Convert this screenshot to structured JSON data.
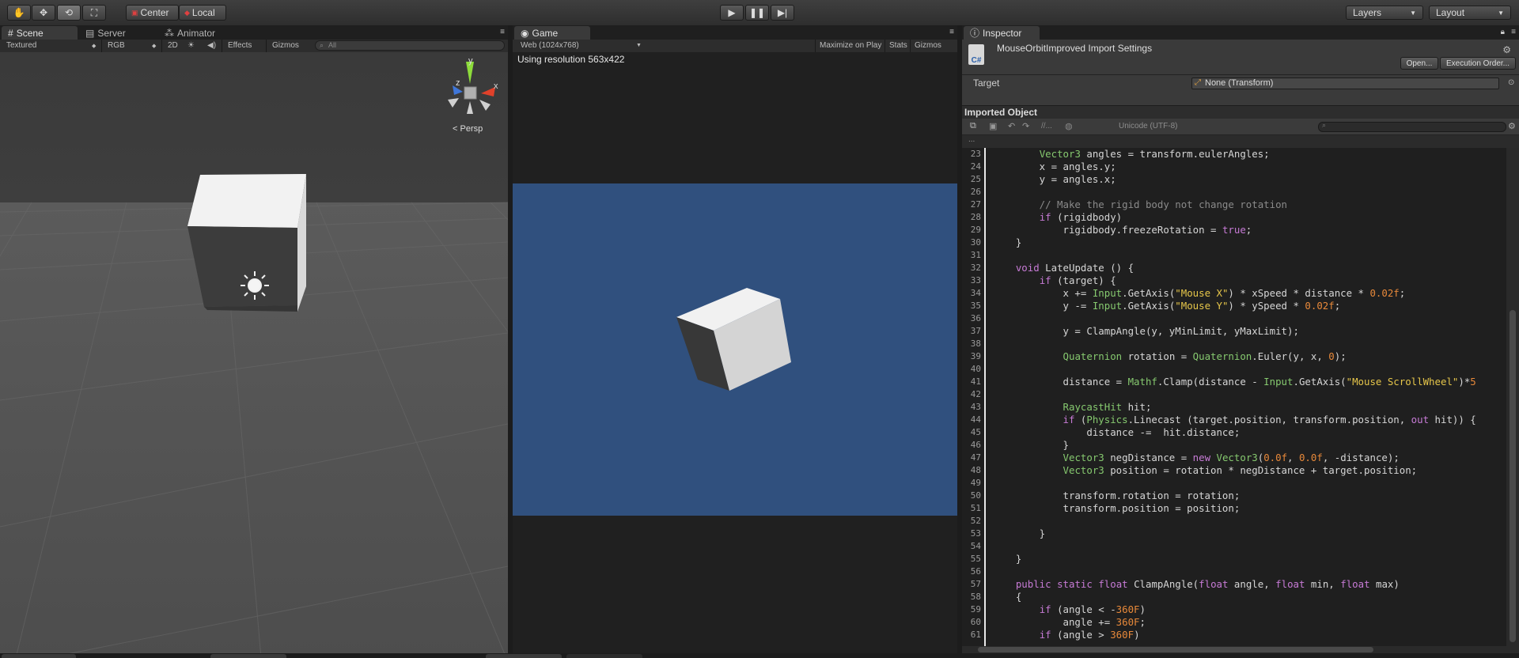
{
  "toolbar": {
    "pivot_center": "Center",
    "pivot_local": "Local",
    "layers": "Layers",
    "layout": "Layout"
  },
  "scene": {
    "tab_scene": "Scene",
    "tab_server": "Server",
    "tab_animator": "Animator",
    "draw_mode": "Textured",
    "render_mode": "RGB",
    "btn_2d": "2D",
    "effects": "Effects",
    "gizmos": "Gizmos",
    "search_placeholder": "All",
    "persp": "Persp",
    "gizmo_x": "x",
    "gizmo_y": "y",
    "gizmo_z": "z"
  },
  "game": {
    "tab": "Game",
    "resolution": "Web (1024x768)",
    "maximize": "Maximize on Play",
    "stats": "Stats",
    "gizmos": "Gizmos",
    "status": "Using resolution 563x422",
    "bg_color": "#30507e"
  },
  "inspector": {
    "tab": "Inspector",
    "title": "MouseOrbitImproved Import Settings",
    "open_button": "Open...",
    "exec_order_button": "Execution Order...",
    "target_label": "Target",
    "target_value": "None (Transform)",
    "section": "Imported Object",
    "encoding": "Unicode (UTF-8)",
    "comment_btn": "//...",
    "ellipsis": "..."
  },
  "code": {
    "lines": [
      {
        "n": "23",
        "t": "        Vector3 angles = transform.eulerAngles;"
      },
      {
        "n": "24",
        "t": "        x = angles.y;"
      },
      {
        "n": "25",
        "t": "        y = angles.x;"
      },
      {
        "n": "26",
        "t": ""
      },
      {
        "n": "27",
        "t": "        // Make the rigid body not change rotation"
      },
      {
        "n": "28",
        "t": "        if (rigidbody)"
      },
      {
        "n": "29",
        "t": "            rigidbody.freezeRotation = true;"
      },
      {
        "n": "30",
        "t": "    }"
      },
      {
        "n": "31",
        "t": ""
      },
      {
        "n": "32",
        "t": "    void LateUpdate () {"
      },
      {
        "n": "33",
        "t": "        if (target) {"
      },
      {
        "n": "34",
        "t": "            x += Input.GetAxis(\"Mouse X\") * xSpeed * distance * 0.02f;"
      },
      {
        "n": "35",
        "t": "            y -= Input.GetAxis(\"Mouse Y\") * ySpeed * 0.02f;"
      },
      {
        "n": "36",
        "t": ""
      },
      {
        "n": "37",
        "t": "            y = ClampAngle(y, yMinLimit, yMaxLimit);"
      },
      {
        "n": "38",
        "t": ""
      },
      {
        "n": "39",
        "t": "            Quaternion rotation = Quaternion.Euler(y, x, 0);"
      },
      {
        "n": "40",
        "t": ""
      },
      {
        "n": "41",
        "t": "            distance = Mathf.Clamp(distance - Input.GetAxis(\"Mouse ScrollWheel\")*5"
      },
      {
        "n": "42",
        "t": ""
      },
      {
        "n": "43",
        "t": "            RaycastHit hit;"
      },
      {
        "n": "44",
        "t": "            if (Physics.Linecast (target.position, transform.position, out hit)) {"
      },
      {
        "n": "45",
        "t": "                distance -=  hit.distance;"
      },
      {
        "n": "46",
        "t": "            }"
      },
      {
        "n": "47",
        "t": "            Vector3 negDistance = new Vector3(0.0f, 0.0f, -distance);"
      },
      {
        "n": "48",
        "t": "            Vector3 position = rotation * negDistance + target.position;"
      },
      {
        "n": "49",
        "t": ""
      },
      {
        "n": "50",
        "t": "            transform.rotation = rotation;"
      },
      {
        "n": "51",
        "t": "            transform.position = position;"
      },
      {
        "n": "52",
        "t": ""
      },
      {
        "n": "53",
        "t": "        }"
      },
      {
        "n": "54",
        "t": ""
      },
      {
        "n": "55",
        "t": "    }"
      },
      {
        "n": "56",
        "t": ""
      },
      {
        "n": "57",
        "t": "    public static float ClampAngle(float angle, float min, float max)"
      },
      {
        "n": "58",
        "t": "    {"
      },
      {
        "n": "59",
        "t": "        if (angle < -360F)"
      },
      {
        "n": "60",
        "t": "            angle += 360F;"
      },
      {
        "n": "61",
        "t": "        if (angle > 360F)"
      }
    ]
  }
}
